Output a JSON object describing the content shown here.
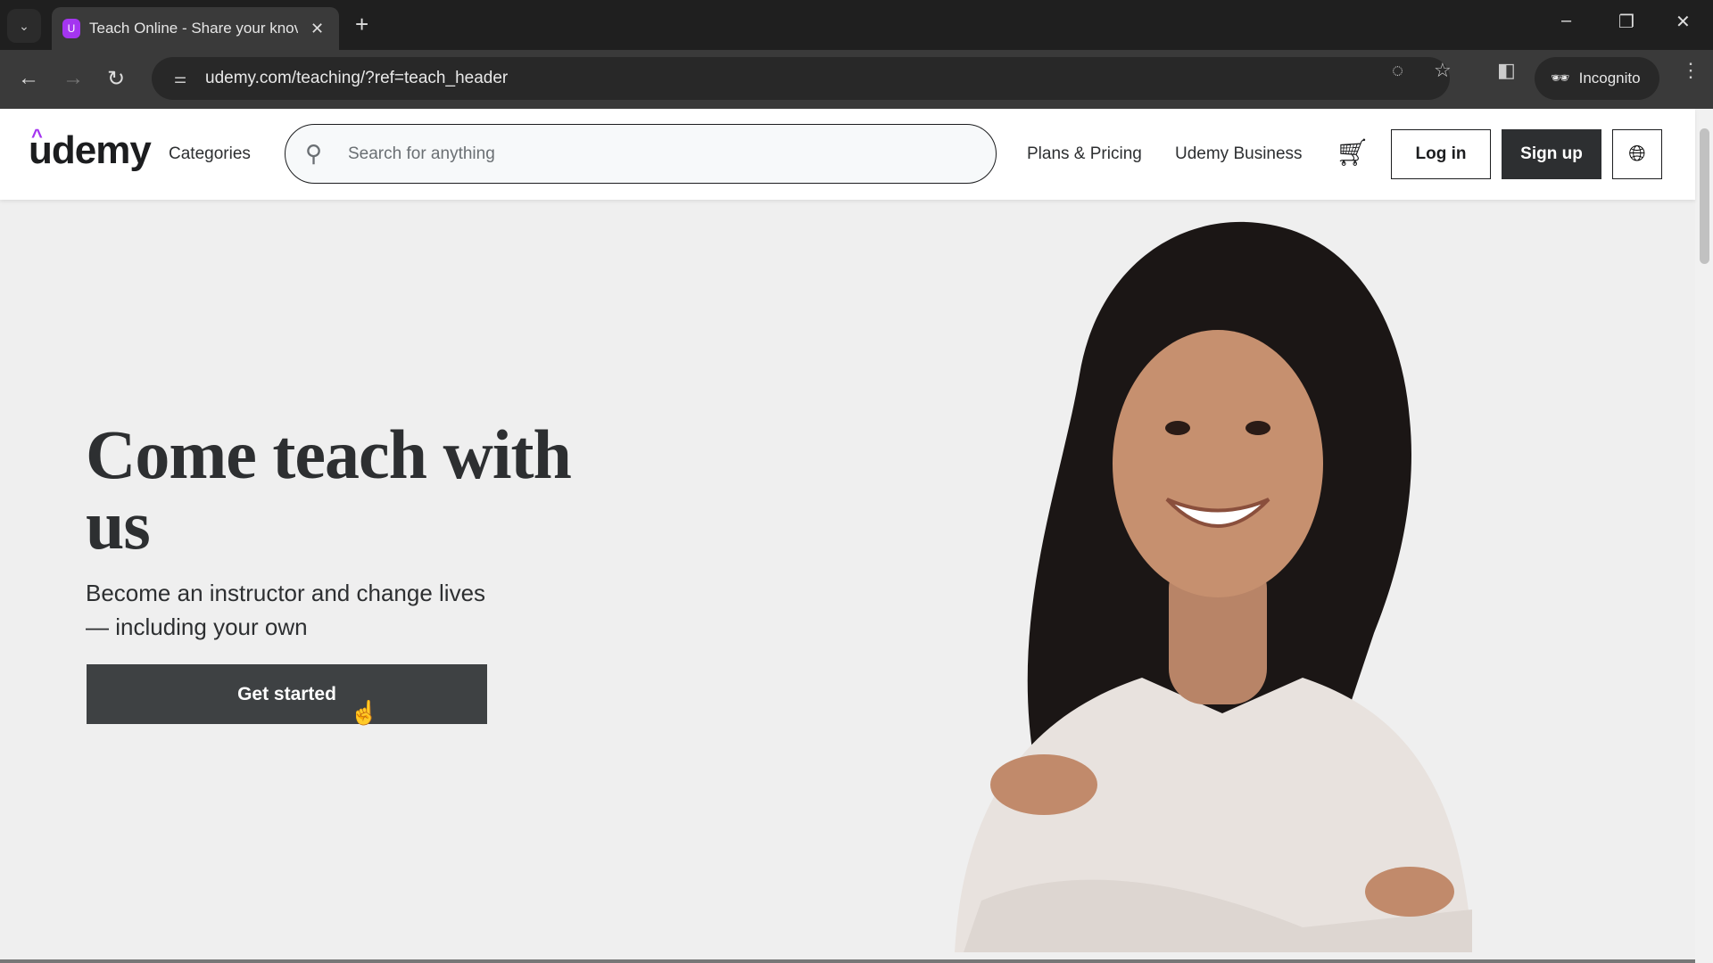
{
  "browser": {
    "tab_title": "Teach Online - Share your knov",
    "url": "udemy.com/teaching/?ref=teach_header",
    "incognito_label": "Incognito"
  },
  "header": {
    "logo": "udemy",
    "categories": "Categories",
    "search_placeholder": "Search for anything",
    "plans": "Plans & Pricing",
    "business": "Udemy Business",
    "login": "Log in",
    "signup": "Sign up"
  },
  "hero": {
    "title": "Come teach with us",
    "subtitle": "Become an instructor and change lives — including your own",
    "cta": "Get started"
  },
  "colors": {
    "brand": "#a435f0",
    "dark": "#2d2f31",
    "hero_bg": "#efefef"
  }
}
